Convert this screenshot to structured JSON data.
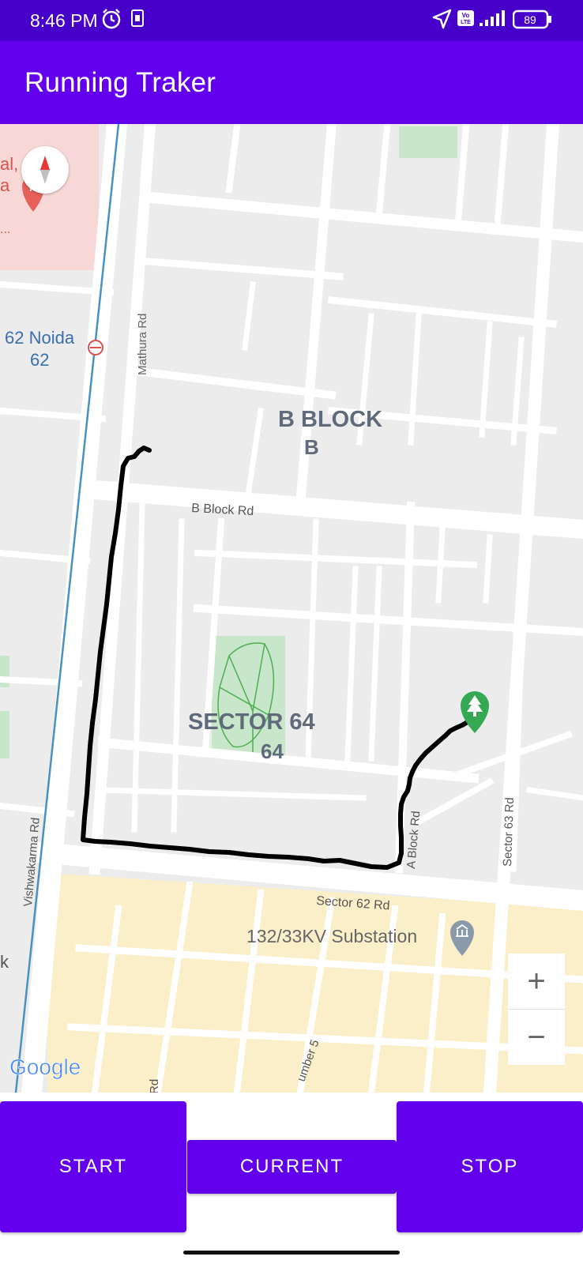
{
  "status_bar": {
    "time": "8:46 PM",
    "battery": "89"
  },
  "app": {
    "title": "Running Traker"
  },
  "map": {
    "labels": {
      "hospital_line1": "al,",
      "hospital_line2": "a",
      "hospital_line3": "...",
      "noida_62_line1": "62 Noida",
      "noida_62_line2": "62",
      "mathura_rd": "Mathura Rd",
      "b_block_line1": "B BLOCK",
      "b_block_line2": "B",
      "b_block_rd": "B Block Rd",
      "sector64_line1": "SECTOR 64",
      "sector64_line2": "64",
      "a_block_rd": "A Block Rd",
      "sector63_rd": "Sector 63 Rd",
      "vishwakarma_rd": "Vishwakarma Rd",
      "sector62_rd": "Sector 62 Rd",
      "substation": "132/33KV Substation",
      "edge_k": "k",
      "bottom_rd": "Rd",
      "number5": "umber 5",
      "google": "Google"
    },
    "zoom_in": "+",
    "zoom_out": "−"
  },
  "buttons": {
    "start": "START",
    "current": "CURRENT",
    "stop": "STOP"
  },
  "colors": {
    "status_bar": "#4600c9",
    "primary": "#6200ee",
    "route": "#000000",
    "park": "#c8e6c9",
    "park_marker": "#34a853"
  }
}
